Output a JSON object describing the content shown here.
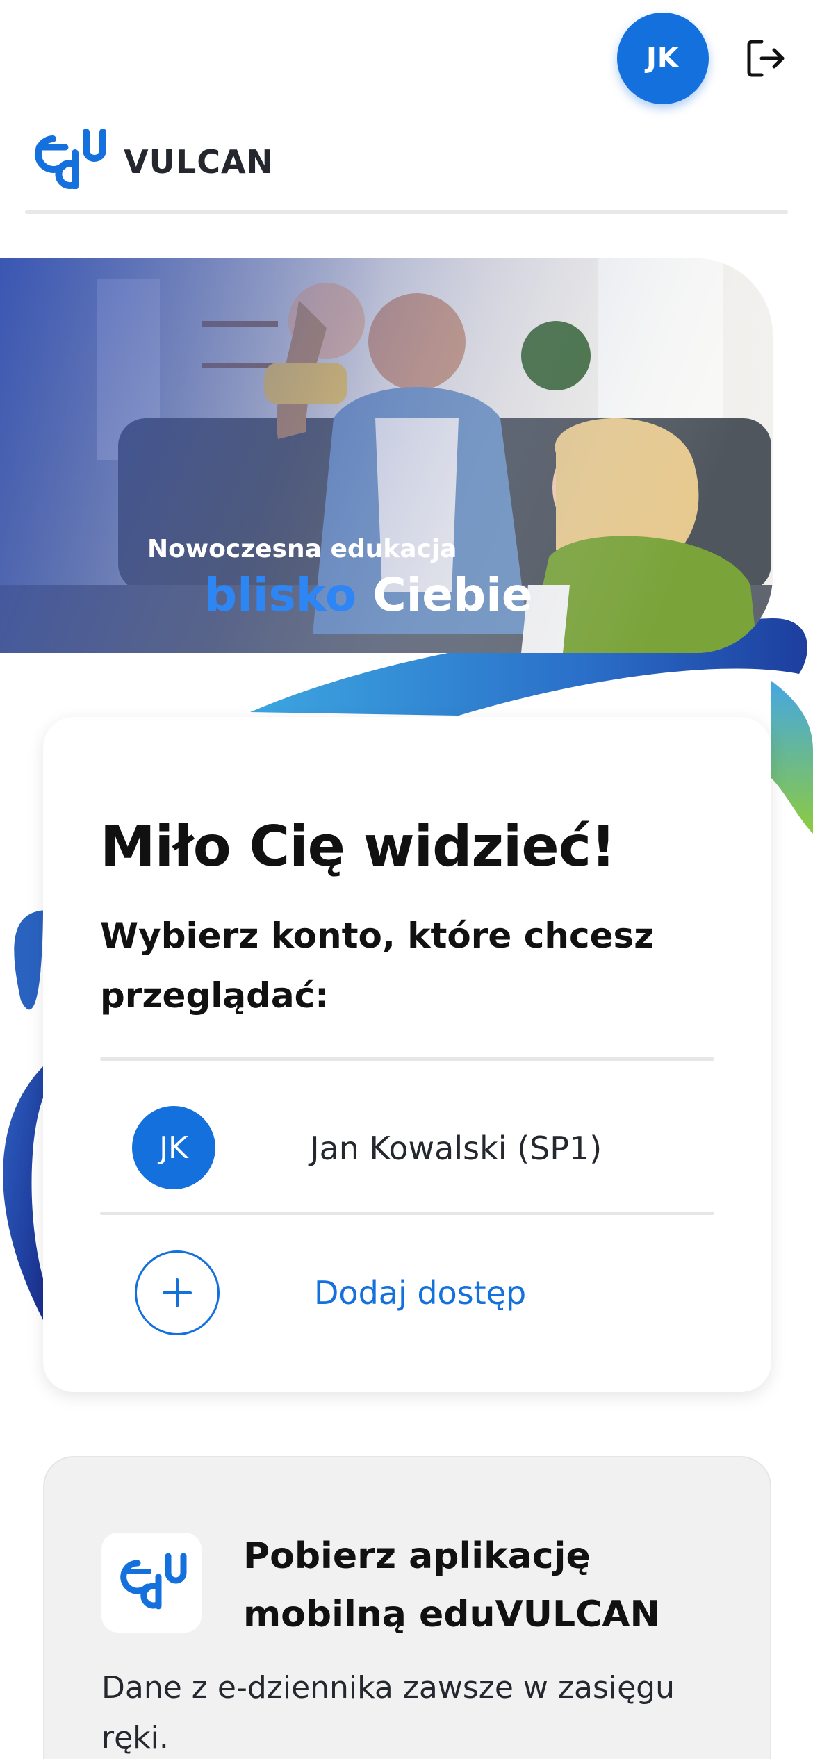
{
  "header": {
    "avatar_initials": "JK",
    "logout_icon": "logout-icon",
    "logo_mark": "edu",
    "logo_text": "VULCAN"
  },
  "hero": {
    "line1": "Nowoczesna edukacja",
    "line2_accent": "blisko",
    "line2_rest": "Ciebie"
  },
  "accounts_card": {
    "title": "Miło Cię widzieć!",
    "subtitle": "Wybierz konto, które chcesz przeglądać:",
    "accounts": [
      {
        "initials": "JK",
        "name": "Jan Kowalski (SP1)"
      }
    ],
    "add_access_label": "Dodaj dostęp",
    "add_icon": "plus-icon"
  },
  "promo_card": {
    "title": "Pobierz aplikację mobilną eduVULCAN",
    "text": "Dane z e-dziennika zawsze w zasięgu ręki.",
    "app_icon": "edu-app-icon"
  },
  "colors": {
    "brand_blue": "#1470DC",
    "accent_blue": "#2E86F5",
    "text_dark": "#111111",
    "divider": "#E4E6E8"
  }
}
